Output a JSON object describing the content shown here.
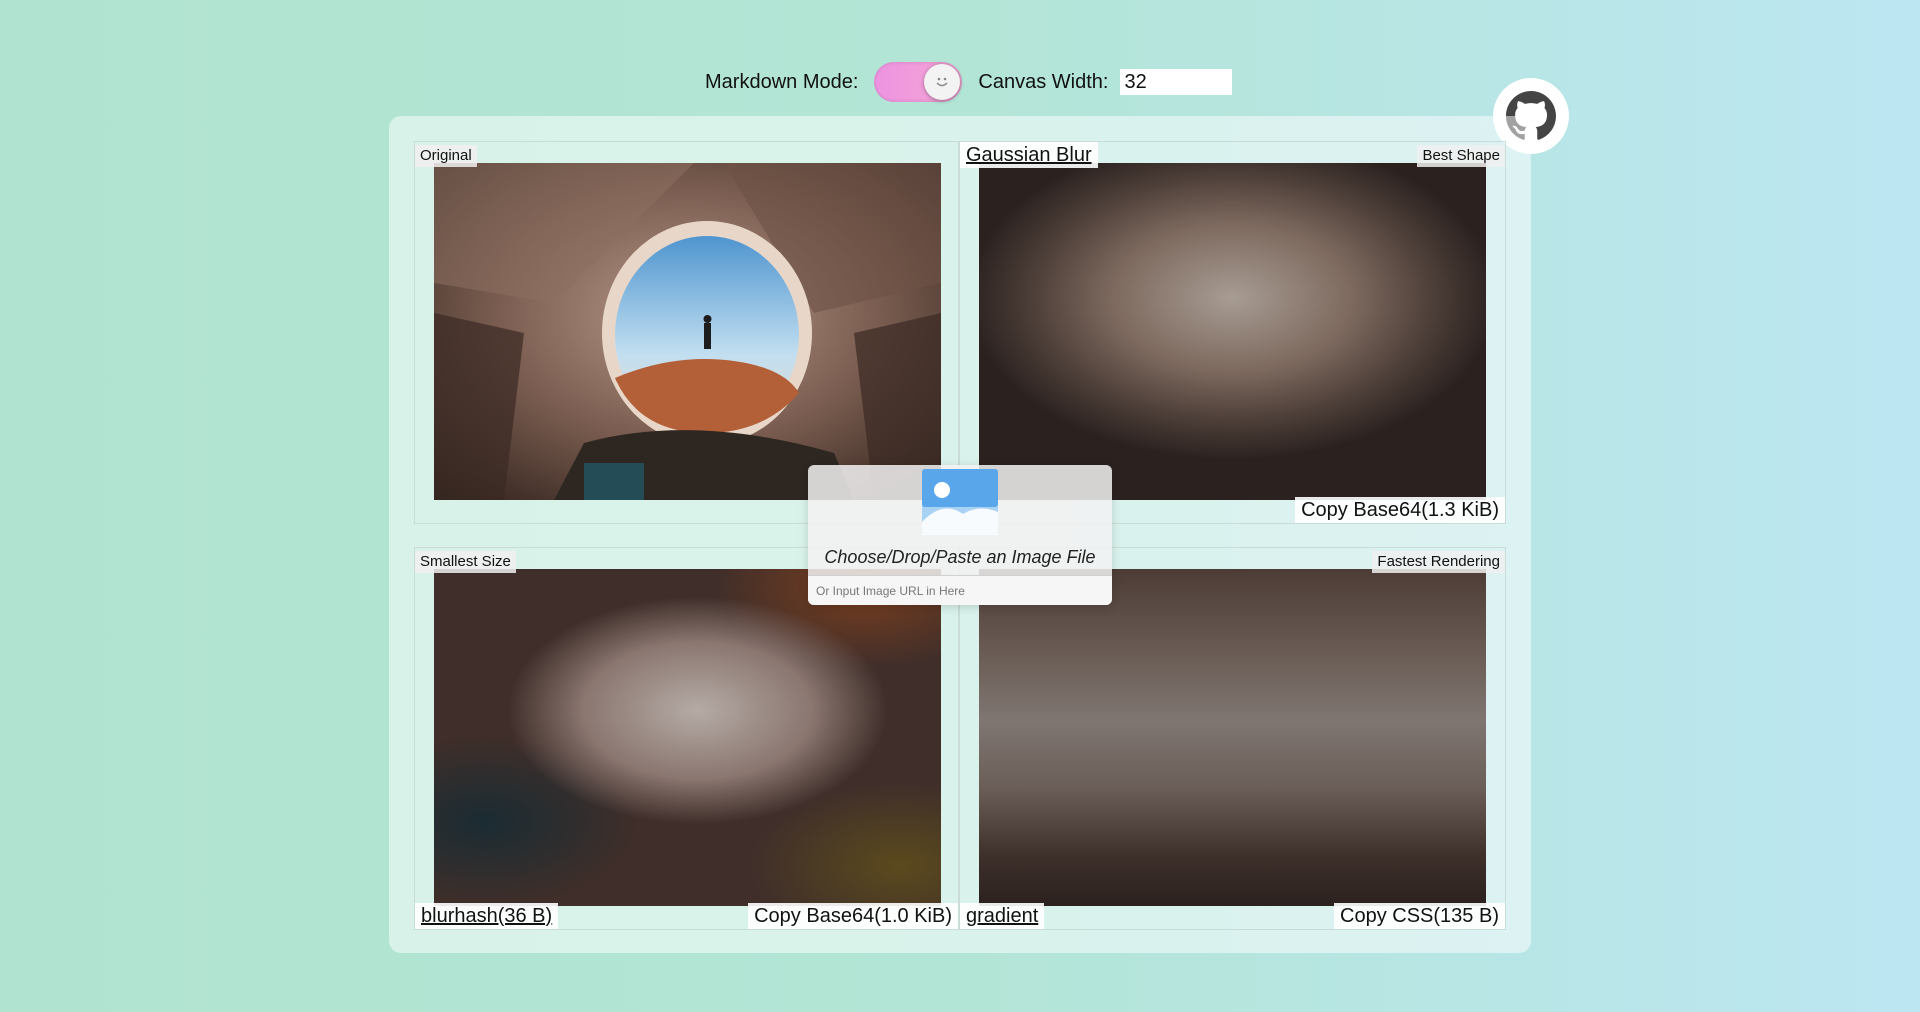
{
  "header": {
    "markdown_label": "Markdown Mode:",
    "markdown_on": true,
    "canvas_label": "Canvas Width:",
    "canvas_value": "32"
  },
  "github": {
    "icon": "github-icon"
  },
  "cells": {
    "original": {
      "label": "Original"
    },
    "gaussian": {
      "title": "Gaussian Blur",
      "badge": "Best Shape",
      "copy": "Copy Base64(1.3 KiB)"
    },
    "blurhash": {
      "badge": "Smallest Size",
      "title": "blurhash(36 B)",
      "copy": "Copy Base64(1.0 KiB)"
    },
    "gradient": {
      "badge": "Fastest Rendering",
      "title": "gradient",
      "copy": "Copy CSS(135 B)"
    }
  },
  "dropzone": {
    "icon": "image-icon",
    "text": "Choose/Drop/Paste an Image File",
    "url_placeholder": "Or Input Image URL in Here"
  }
}
